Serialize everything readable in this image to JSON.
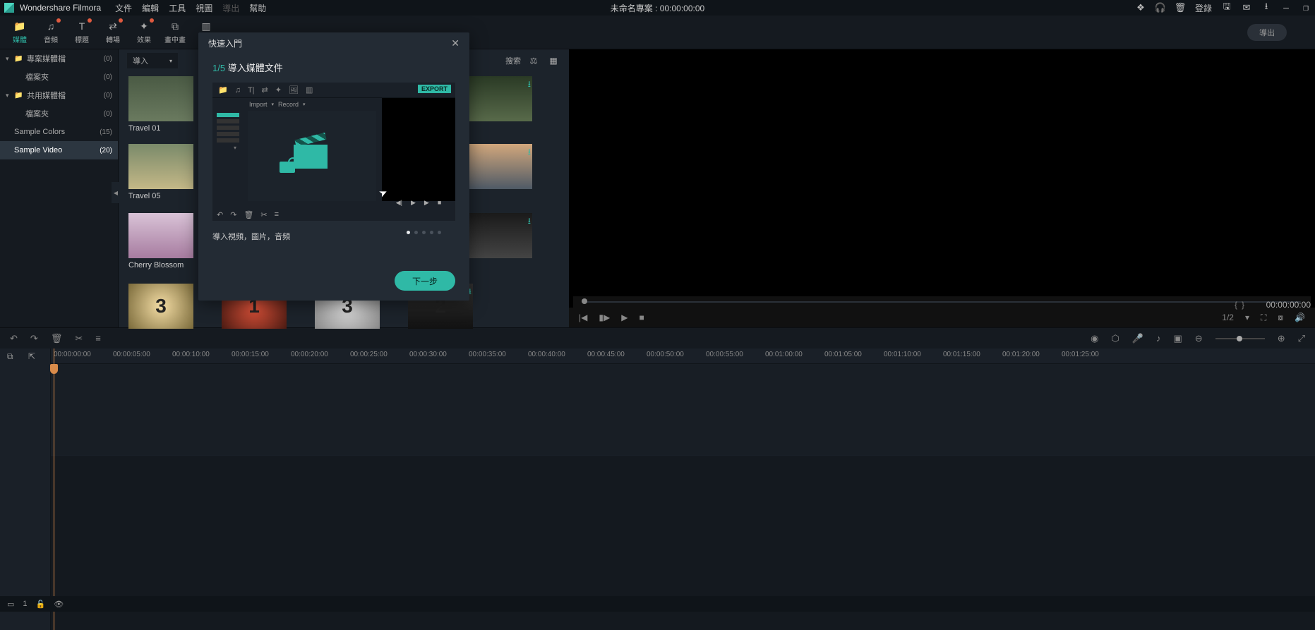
{
  "app": {
    "name": "Wondershare Filmora"
  },
  "menu": {
    "file": "文件",
    "edit": "編輯",
    "tools": "工具",
    "view": "視圖",
    "export": "導出",
    "help": "幫助"
  },
  "titlebar": {
    "project": "未命名專案 : 00:00:00:00",
    "login": "登錄"
  },
  "tabs": {
    "media": "媒體",
    "audio": "音頻",
    "titles": "標題",
    "transitions": "轉場",
    "effects": "效果",
    "pip": "畫中畫",
    "split": "分屏",
    "export": "導出"
  },
  "sidebar": {
    "items": [
      {
        "label": "專案媒體檔",
        "count": "(0)",
        "folder": true,
        "expandable": true
      },
      {
        "label": "檔案夾",
        "count": "(0)",
        "indent": true
      },
      {
        "label": "共用媒體檔",
        "count": "(0)",
        "folder": true,
        "expandable": true
      },
      {
        "label": "檔案夾",
        "count": "(0)",
        "indent": true
      },
      {
        "label": "Sample Colors",
        "count": "(15)"
      },
      {
        "label": "Sample Video",
        "count": "(20)",
        "selected": true
      }
    ]
  },
  "mediaBar": {
    "import": "導入",
    "search": "搜索"
  },
  "thumbs": [
    {
      "label": "Travel 01",
      "cls": "bg-bike1"
    },
    {
      "label": "",
      "cls": "bg-leaves",
      "dl": true
    },
    {
      "label": "Travel 05",
      "cls": "bg-bike2"
    },
    {
      "label": "",
      "cls": "bg-sunset",
      "dl": true
    },
    {
      "label": "Cherry Blossom",
      "cls": "bg-blossom"
    },
    {
      "label": "",
      "cls": "bg-dark",
      "dl": true
    },
    {
      "label": "",
      "cls": "bg-count1",
      "num": "3"
    },
    {
      "label": "",
      "cls": "bg-count2",
      "num": "1"
    },
    {
      "label": "",
      "cls": "bg-count3",
      "num": "3"
    },
    {
      "label": "",
      "cls": "bg-count4",
      "num": "2",
      "dl": true
    }
  ],
  "preview": {
    "time": "00:00:00:00",
    "ratio": "1/2"
  },
  "modal": {
    "title": "快速入門",
    "step": "1/5",
    "step_title": "導入媒體文件",
    "body": {
      "import": "Import",
      "record": "Record",
      "export": "EXPORT"
    },
    "desc": "導入視頻，圖片，音頻",
    "next": "下一步"
  },
  "timeline": {
    "ticks": [
      "00:00:00:00",
      "00:00:05:00",
      "00:00:10:00",
      "00:00:15:00",
      "00:00:20:00",
      "00:00:25:00",
      "00:00:30:00",
      "00:00:35:00",
      "00:00:40:00",
      "00:00:45:00",
      "00:00:50:00",
      "00:00:55:00",
      "00:01:00:00",
      "00:01:05:00",
      "00:01:10:00",
      "00:01:15:00",
      "00:01:20:00",
      "00:01:25:00"
    ],
    "trackLabel": "1"
  }
}
